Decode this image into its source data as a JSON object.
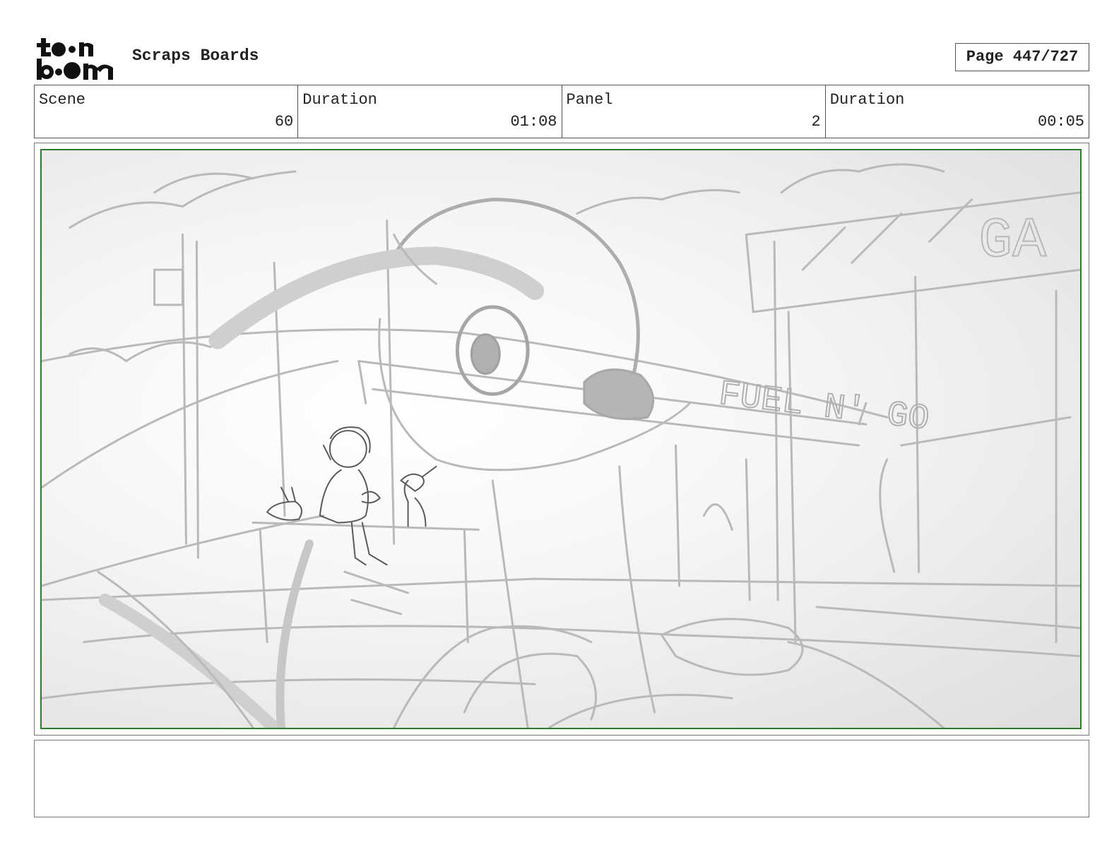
{
  "header": {
    "logo_top": "t●●n",
    "logo_bottom": "b●●m",
    "title": "Scraps Boards",
    "page_label": "Page 447/727"
  },
  "info": {
    "scene_label": "Scene",
    "scene_value": "60",
    "scene_duration_label": "Duration",
    "scene_duration_value": "01:08",
    "panel_label": "Panel",
    "panel_value": "2",
    "panel_duration_label": "Duration",
    "panel_duration_value": "00:05"
  },
  "panel": {
    "sign_text": "FUEL N' GO",
    "sign_partial": "GA",
    "frame_color": "#2f7a2f"
  },
  "notes": {
    "text": ""
  }
}
